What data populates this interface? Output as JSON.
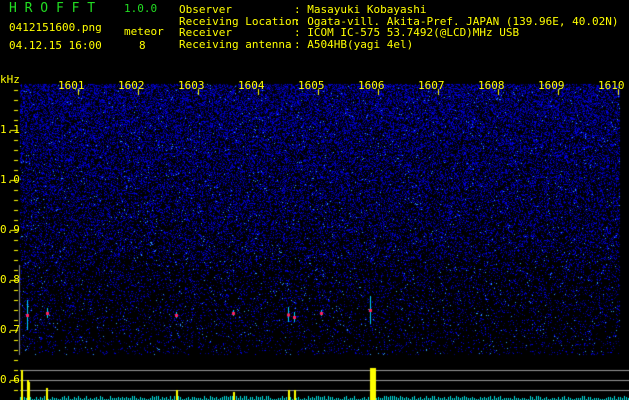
{
  "header": {
    "app_name": "H R O F F T",
    "version": "1.0.0",
    "filename": "0412151600.png",
    "datetime": "04.12.15 16:00",
    "meteor_label": "meteor",
    "meteor_count": "8",
    "info": [
      {
        "label": "Observer",
        "value": ": Masayuki Kobayashi"
      },
      {
        "label": "Receiving Location",
        "value": ": Ogata-vill. Akita-Pref. JAPAN (139.96E, 40.02N)"
      },
      {
        "label": "Receiver",
        "value": ": ICOM IC-575 53.7492(@LCD)MHz USB"
      },
      {
        "label": "Receiving antenna",
        "value": ": A504HB(yagi 4el)"
      }
    ]
  },
  "spectrogram": {
    "y_unit": "kHz",
    "x_ticks": [
      "1601",
      "1602",
      "1603",
      "1604",
      "1605",
      "1606",
      "1607",
      "1608",
      "1609",
      "1610"
    ],
    "y_ticks": [
      "1.1",
      "1.0",
      "0.9",
      "0.8",
      "0.7",
      "0.6"
    ],
    "colors": {
      "text": "#ffff00",
      "logo": "#22dd22",
      "noise": "#1a1aff",
      "histogram_noise": "#00e5e5",
      "histogram_peak": "#ffff00"
    }
  }
}
